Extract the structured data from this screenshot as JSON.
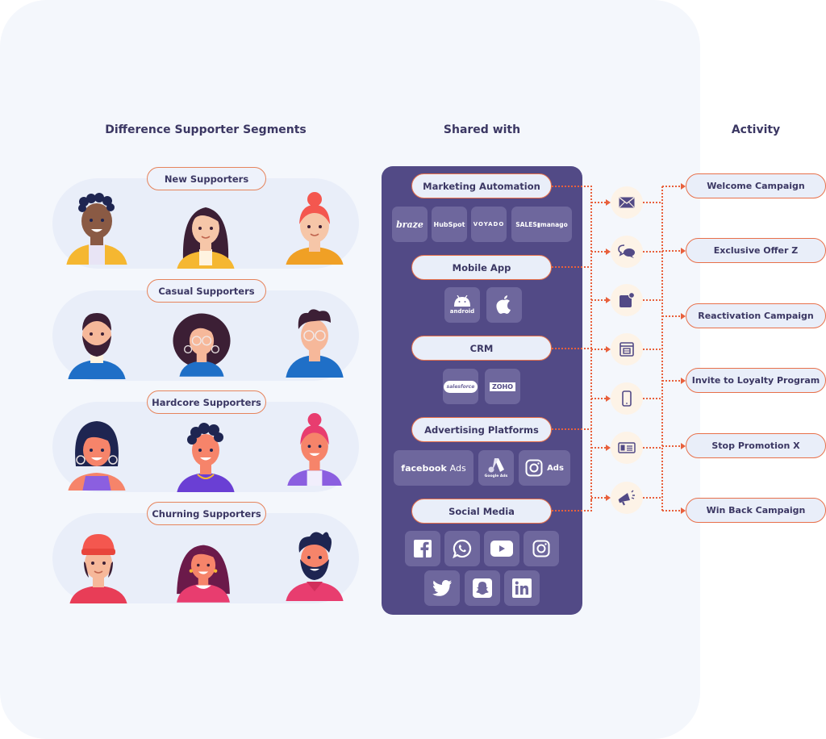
{
  "headers": {
    "segments": "Difference Supporter Segments",
    "shared_with": "Shared with",
    "activity": "Activity"
  },
  "segments": [
    {
      "label": "New Supporters",
      "avatars": [
        "young-man-curly-hair",
        "woman-long-hair",
        "woman-red-bun"
      ]
    },
    {
      "label": "Casual Supporters",
      "avatars": [
        "bearded-man",
        "woman-curly-glasses",
        "man-glasses-hoodie"
      ]
    },
    {
      "label": "Hardcore Supporters",
      "avatars": [
        "woman-short-hair-earrings",
        "man-curly-hair-chain",
        "woman-pink-bun"
      ]
    },
    {
      "label": "Churning Supporters",
      "avatars": [
        "man-red-beanie",
        "woman-long-hair-collar",
        "bearded-man-spiky-hair"
      ]
    }
  ],
  "channels": [
    {
      "label": "Marketing Automation",
      "tools": [
        "braze",
        "HubSpot",
        "VOYADO",
        "SALESmanago"
      ]
    },
    {
      "label": "Mobile App",
      "tools": [
        "android",
        "apple"
      ]
    },
    {
      "label": "CRM",
      "tools": [
        "salesforce",
        "ZOHO"
      ]
    },
    {
      "label": "Advertising Platforms",
      "tools": [
        "facebook Ads",
        "Google Ads",
        "Ads"
      ]
    },
    {
      "label": "Social Media",
      "tools": [
        "facebook",
        "whatsapp",
        "youtube",
        "instagram",
        "twitter",
        "snapchat",
        "linkedin"
      ]
    }
  ],
  "tool_text": {
    "braze": "braze",
    "hubspot": "HubSpot",
    "voyado": "VOYADO",
    "salesmanago": "SALES▮manago",
    "android": "android",
    "salesforce": "salesforce",
    "zoho": "ZOHO",
    "facebook_ads_brand": "facebook",
    "facebook_ads_suffix": "Ads",
    "google_ads": "Google Ads",
    "instagram_ads": "Ads"
  },
  "activity_icons": [
    "email-icon",
    "chat-icon",
    "notification-icon",
    "web-page-icon",
    "mobile-icon",
    "id-card-icon",
    "megaphone-icon"
  ],
  "activities": [
    "Welcome Campaign",
    "Exclusive Offer Z",
    "Reactivation Campaign",
    "Invite to Loyalty Program",
    "Stop Promotion X",
    "Win Back Campaign"
  ],
  "colors": {
    "panel_bg": "#f4f7fc",
    "shared_panel": "#524a86",
    "accent_orange": "#e8704a",
    "text_dark": "#3b3763",
    "icon_circle": "#fdf3e7"
  }
}
